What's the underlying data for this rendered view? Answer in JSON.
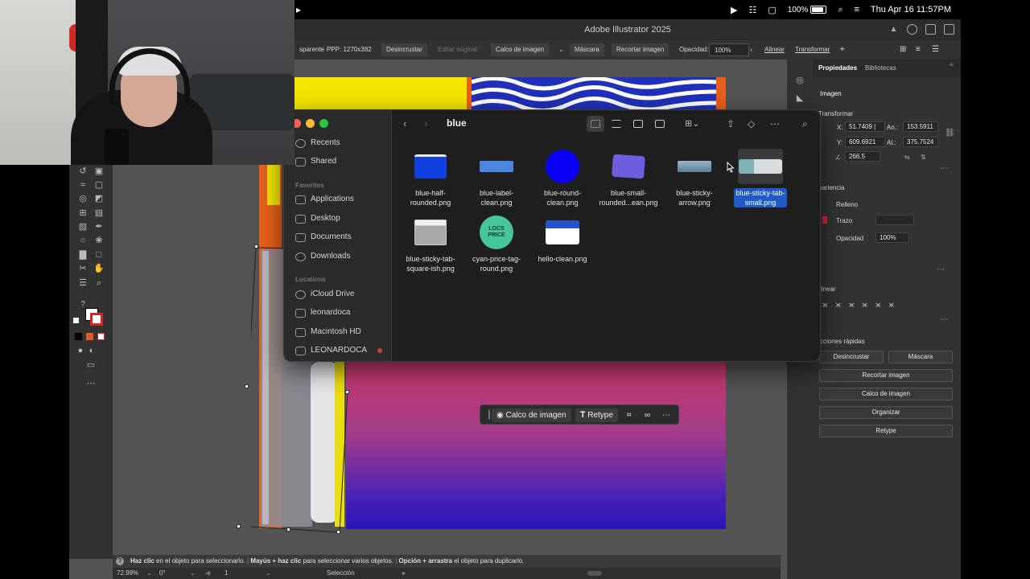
{
  "menubar": {
    "battery": "100%",
    "datetime": "Thu Apr 16  11:57PM"
  },
  "illustrator": {
    "title": "Adobe Illustrator 2025",
    "control": {
      "transparent": "sparente",
      "ppp": "PPP: 1270x382",
      "desincrustar": "Desincrustar",
      "editar_original": "Editar original",
      "calco": "Calco de imagen",
      "mascara": "Máscara",
      "recortar": "Recortar imagen",
      "opacidad_label": "Opacidad:",
      "opacidad_value": "100%",
      "alinear": "Alinear",
      "transformar": "Transformar"
    },
    "statusbar": {
      "help": "?",
      "part1_bold": "Haz clic",
      "part1": " en el objeto para seleccionarlo.",
      "part2_bold": "Mayús + haz clic",
      "part2": " para seleccionar varios objetos.",
      "part3_bold": "Opción + arrastra",
      "part3": " el objeto para duplicarlo."
    },
    "bottombar": {
      "zoom": "72.99%",
      "rotation": "0°",
      "artboard": "1",
      "mode": "Selección"
    },
    "taskbar": {
      "calco": "Calco de imagen",
      "retype": "Retype"
    }
  },
  "properties": {
    "tab_props": "Propiedades",
    "tab_libs": "Bibliotecas",
    "section_imagen": "Imagen",
    "section_transform": "Transformar",
    "x_label": "X:",
    "x_value": "51.7409 |",
    "an_label": "An.:",
    "an_value": "153.5911",
    "y_label": "Y:",
    "y_value": "609.6921",
    "al_label": "Al.:",
    "al_value": "375.7524",
    "angle_value": "266.5",
    "section_apariencia": "pariencia",
    "relleno": "Relleno",
    "trazo": "Trazo",
    "opacidad": "Opacidad",
    "opacidad_value": "100%",
    "section_alinear": "linear",
    "section_acciones": "cciones rápidas",
    "btn_desincrustar": "Desincrustar",
    "btn_mascara": "Máscara",
    "btn_recortar": "Recortar imagen",
    "btn_calco": "Calco de imagen",
    "btn_organizar": "Organizar",
    "btn_retype": "Retype"
  },
  "finder": {
    "folder_title": "blue",
    "sidebar": {
      "recents": "Recents",
      "shared": "Shared",
      "favorites_header": "Favorites",
      "favorites": [
        "Applications",
        "Desktop",
        "Documents",
        "Downloads"
      ],
      "locations_header": "Locations",
      "locations": [
        "iCloud Drive",
        "leonardoca",
        "Macintosh HD",
        "LEONARDOCA"
      ]
    },
    "files": [
      {
        "name": "blue-half-\nrounded.png"
      },
      {
        "name": "blue-label-\nclean.png"
      },
      {
        "name": "blue-round-\nclean.png"
      },
      {
        "name": "blue-small-\nrounded...ean.png"
      },
      {
        "name": "blue-sticky-\narrow.png"
      },
      {
        "name": "blue-sticky-tab-\nsmall.png"
      },
      {
        "name": "blue-sticky-tab-\nsquare-ish.png"
      },
      {
        "name": "cyan-price-tag-\nround.png"
      },
      {
        "name": "hello-clean.png"
      }
    ],
    "cyan_thumb_text": "LOCS PRICE"
  },
  "colors": {
    "finder_selection": "#1f5bc8",
    "traffic_red": "#ff5f57",
    "traffic_yellow": "#febc2e",
    "traffic_green": "#28c840"
  }
}
